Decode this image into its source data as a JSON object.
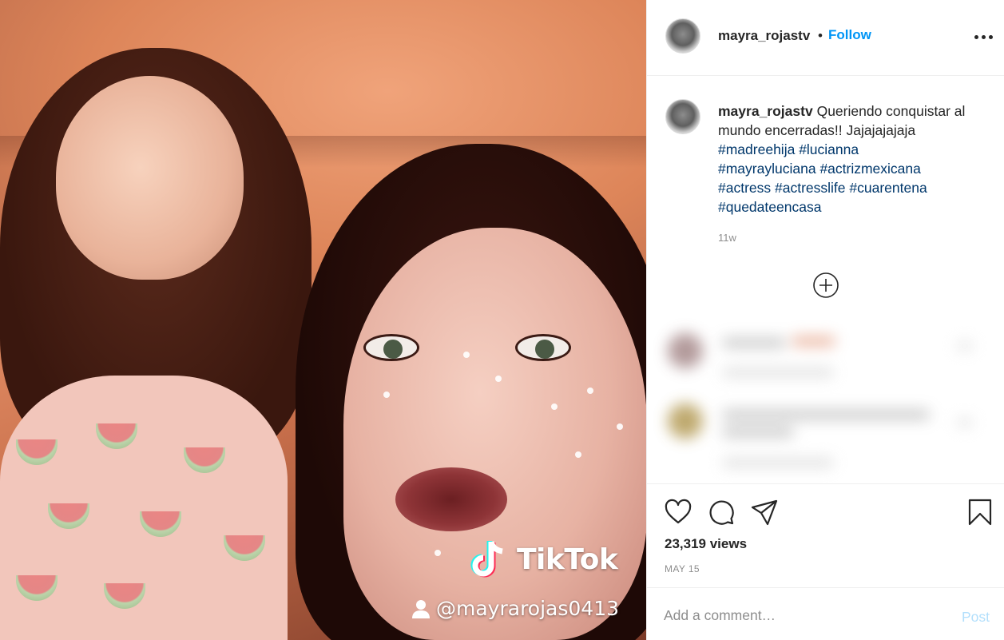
{
  "media": {
    "watermark_brand": "TikTok",
    "watermark_handle": "@mayrarojas0413"
  },
  "header": {
    "username": "mayra_rojastv",
    "separator": "•",
    "follow_label": "Follow"
  },
  "caption": {
    "username": "mayra_rojastv",
    "text": "Queriendo conquistar al mundo encerradas!! Jajajajajaja",
    "hashtags": [
      "#madreehija",
      "#lucianna",
      "#mayrayluciana",
      "#actrizmexicana",
      "#actress",
      "#actresslife",
      "#cuarentena",
      "#quedateencasa"
    ],
    "time_ago": "11w"
  },
  "stats": {
    "views": "23,319 views",
    "date": "MAY 15"
  },
  "comment_box": {
    "placeholder": "Add a comment…",
    "post_label": "Post"
  },
  "colors": {
    "link_blue": "#0095f6",
    "hashtag": "#00376b",
    "muted": "#8e8e8e",
    "post_disabled": "#b2dffc"
  },
  "icons": [
    "more-icon",
    "load-more-comments-icon",
    "heart-icon",
    "comment-icon",
    "share-icon",
    "bookmark-icon",
    "tiktok-note-icon",
    "user-icon"
  ]
}
